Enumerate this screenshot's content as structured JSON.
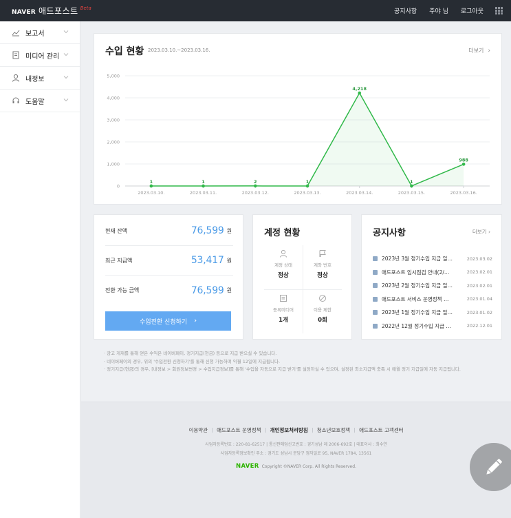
{
  "header": {
    "brand_naver": "NAVER",
    "brand_name": "애드포스트",
    "brand_beta": "Beta",
    "links": [
      "공지사항",
      "주야 님",
      "로그아웃"
    ]
  },
  "sidebar": {
    "items": [
      {
        "label": "보고서",
        "icon": "chart-line-icon"
      },
      {
        "label": "미디어 관리",
        "icon": "document-icon"
      },
      {
        "label": "내정보",
        "icon": "user-icon"
      },
      {
        "label": "도움말",
        "icon": "headset-icon"
      }
    ]
  },
  "revenue": {
    "title": "수입 현황",
    "range": "2023.03.10.~2023.03.16.",
    "more": "더보기"
  },
  "chart_data": {
    "type": "area",
    "categories": [
      "2023.03.10.",
      "2023.03.11.",
      "2023.03.12.",
      "2023.03.13.",
      "2023.03.14.",
      "2023.03.15.",
      "2023.03.16."
    ],
    "values": [
      1,
      1,
      2,
      1,
      4218,
      1,
      988
    ],
    "value_labels": [
      "1",
      "1",
      "2",
      "1",
      "4,218",
      "1",
      "988"
    ],
    "yticks": [
      "0",
      "1,000",
      "2,000",
      "3,000",
      "4,000",
      "5,000"
    ],
    "ylim": [
      0,
      5000
    ],
    "grid": true,
    "color": "#31b94a"
  },
  "balance": {
    "rows": [
      {
        "label": "현재 잔액",
        "value": "76,599",
        "unit": "원"
      },
      {
        "label": "최근 지급액",
        "value": "53,417",
        "unit": "원"
      },
      {
        "label": "전환 가능 금액",
        "value": "76,599",
        "unit": "원"
      }
    ],
    "button": "수입전환 신청하기"
  },
  "account": {
    "title": "계정 현황",
    "cells": [
      {
        "label": "계정 상태",
        "value": "정상",
        "icon": "person-icon"
      },
      {
        "label": "계좌 번호",
        "value": "정상",
        "icon": "flag-icon"
      },
      {
        "label": "등록미디어",
        "value": "1개",
        "icon": "media-icon"
      },
      {
        "label": "이용 제한",
        "value": "0회",
        "icon": "ban-icon"
      }
    ]
  },
  "notice": {
    "title": "공지사항",
    "more": "더보기",
    "items": [
      {
        "text": "2023년 3월 정기수입 지급 일…",
        "date": "2023.03.02"
      },
      {
        "text": "애드포스트 임시점검 안내(2/…",
        "date": "2023.02.01"
      },
      {
        "text": "2023년 2월 정기수입 지급 일…",
        "date": "2023.02.01"
      },
      {
        "text": "애드포스트 서비스 운영정책 …",
        "date": "2023.01.04"
      },
      {
        "text": "2023년 1월 정기수입 지급 일…",
        "date": "2023.01.02"
      },
      {
        "text": "2022년 12월 정기수입 지급 …",
        "date": "2022.12.01"
      }
    ]
  },
  "notes": [
    "· 광고 게재를 통해 얻은 수익은 네이버페이, 정기지급(현금) 등으로 지급 받으실 수 있습니다.",
    "· 네이버페이의 경우, 위의 '수입전환 신청하기'를 통해 신청 가능하며 익월 12일에 지급됩니다.",
    "· 정기지급(현금)의 경우, [내정보 > 회원정보변경 > 수입지급정보]를 통해 '수입을 자동으로 지급 받기'를 설정하실 수 있으며, 설정된 최소지급액 충족 시 매월 정기 지급일에 자동 지급됩니다."
  ],
  "footer": {
    "links": [
      "이용약관",
      "애드포스트 운영정책",
      "개인정보처리방침",
      "청소년보호정책",
      "애드포스트 고객센터"
    ],
    "info1": "사업자등록번호 : 220-81-62517  |  통신판매업신고번호 : 경기성남 제 2006-692호  |  대표이사 : 최수연",
    "info2": "사업자등록정보확인 주소 : 경기도 성남시 분당구 정자일로 95, NAVER 1784, 13561",
    "naver": "NAVER",
    "copyright": "Copyright ©NAVER Corp. All Rights Reserved."
  }
}
